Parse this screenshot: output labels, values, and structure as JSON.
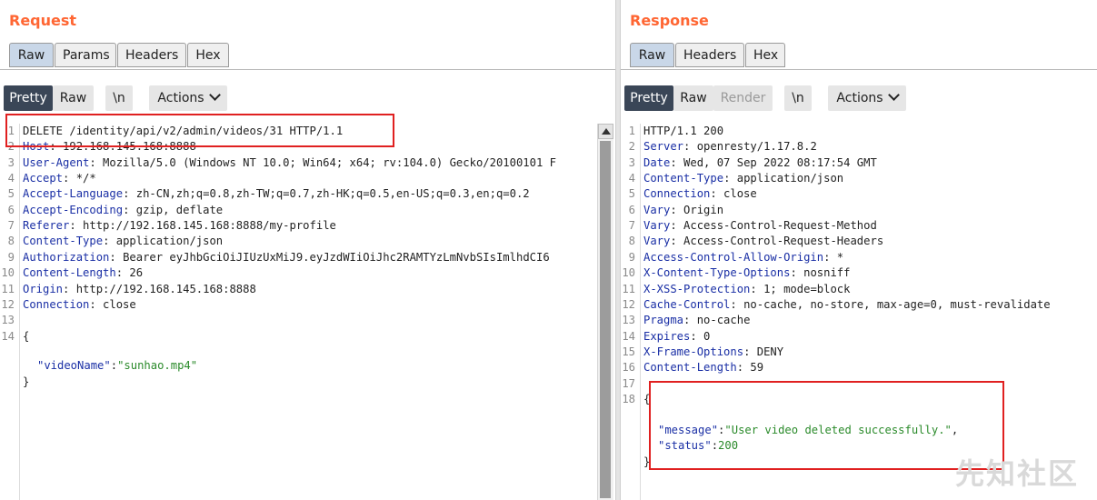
{
  "request": {
    "title": "Request",
    "tabs": [
      "Raw",
      "Params",
      "Headers",
      "Hex"
    ],
    "active_tab": "Raw",
    "view_buttons": {
      "pretty": "Pretty",
      "raw": "Raw",
      "newline": "\\n",
      "actions": "Actions"
    },
    "lines": [
      {
        "n": "1",
        "key": "",
        "val": "DELETE /identity/api/v2/admin/videos/31 HTTP/1.1"
      },
      {
        "n": "2",
        "key": "Host",
        "val": ": 192.168.145.168:8888"
      },
      {
        "n": "3",
        "key": "User-Agent",
        "val": ": Mozilla/5.0 (Windows NT 10.0; Win64; x64; rv:104.0) Gecko/20100101 F"
      },
      {
        "n": "4",
        "key": "Accept",
        "val": ": */*"
      },
      {
        "n": "5",
        "key": "Accept-Language",
        "val": ": zh-CN,zh;q=0.8,zh-TW;q=0.7,zh-HK;q=0.5,en-US;q=0.3,en;q=0.2"
      },
      {
        "n": "6",
        "key": "Accept-Encoding",
        "val": ": gzip, deflate"
      },
      {
        "n": "7",
        "key": "Referer",
        "val": ": http://192.168.145.168:8888/my-profile"
      },
      {
        "n": "8",
        "key": "Content-Type",
        "val": ": application/json"
      },
      {
        "n": "9",
        "key": "Authorization",
        "val": ": Bearer eyJhbGciOiJIUzUxMiJ9.eyJzdWIiOiJhc2RAMTYzLmNvbSIsImlhdCI6"
      },
      {
        "n": "10",
        "key": "Content-Length",
        "val": ": 26"
      },
      {
        "n": "11",
        "key": "Origin",
        "val": ": http://192.168.145.168:8888"
      },
      {
        "n": "12",
        "key": "Connection",
        "val": ": close"
      },
      {
        "n": "13",
        "key": "",
        "val": ""
      },
      {
        "n": "14",
        "key": "",
        "val": "{"
      }
    ],
    "body": {
      "key": "\"videoName\"",
      "colon": ":",
      "value": "\"sunhao.mp4\"",
      "close": "}"
    }
  },
  "response": {
    "title": "Response",
    "tabs": [
      "Raw",
      "Headers",
      "Hex"
    ],
    "active_tab": "Raw",
    "view_buttons": {
      "pretty": "Pretty",
      "raw": "Raw",
      "render": "Render",
      "newline": "\\n",
      "actions": "Actions"
    },
    "lines": [
      {
        "n": "1",
        "key": "",
        "val": "HTTP/1.1 200"
      },
      {
        "n": "2",
        "key": "Server",
        "val": ": openresty/1.17.8.2"
      },
      {
        "n": "3",
        "key": "Date",
        "val": ": Wed, 07 Sep 2022 08:17:54 GMT"
      },
      {
        "n": "4",
        "key": "Content-Type",
        "val": ": application/json"
      },
      {
        "n": "5",
        "key": "Connection",
        "val": ": close"
      },
      {
        "n": "6",
        "key": "Vary",
        "val": ": Origin"
      },
      {
        "n": "7",
        "key": "Vary",
        "val": ": Access-Control-Request-Method"
      },
      {
        "n": "8",
        "key": "Vary",
        "val": ": Access-Control-Request-Headers"
      },
      {
        "n": "9",
        "key": "Access-Control-Allow-Origin",
        "val": ": *"
      },
      {
        "n": "10",
        "key": "X-Content-Type-Options",
        "val": ": nosniff"
      },
      {
        "n": "11",
        "key": "X-XSS-Protection",
        "val": ": 1; mode=block"
      },
      {
        "n": "12",
        "key": "Cache-Control",
        "val": ": no-cache, no-store, max-age=0, must-revalidate"
      },
      {
        "n": "13",
        "key": "Pragma",
        "val": ": no-cache"
      },
      {
        "n": "14",
        "key": "Expires",
        "val": ": 0"
      },
      {
        "n": "15",
        "key": "X-Frame-Options",
        "val": ": DENY"
      },
      {
        "n": "16",
        "key": "Content-Length",
        "val": ": 59"
      },
      {
        "n": "17",
        "key": "",
        "val": ""
      },
      {
        "n": "18",
        "key": "",
        "val": "{"
      }
    ],
    "body": {
      "message_key": "\"message\"",
      "message_value": "\"User video deleted successfully.\"",
      "message_comma": ",",
      "status_key": "\"status\"",
      "status_value": "200",
      "colon": ":",
      "close": "}"
    }
  },
  "watermark": "先知社区",
  "colors": {
    "title": "#ff6633",
    "header_key": "#1a2fa5",
    "json_string": "#2a8a2a",
    "highlight": "#e02020",
    "active_button": "#3a4657"
  }
}
